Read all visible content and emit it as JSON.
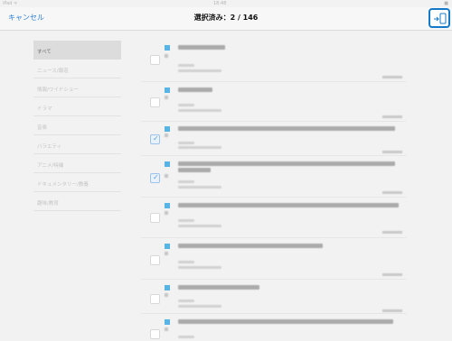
{
  "status_bar": {
    "left": "iPad ᯤ",
    "center": "18:48",
    "right": "■"
  },
  "navbar": {
    "cancel_label": "キャンセル",
    "title": "選択済み：2 / 146"
  },
  "sidebar": {
    "items": [
      {
        "label": "すべて",
        "active": true
      },
      {
        "label": "ニュース/報道",
        "active": false
      },
      {
        "label": "情報/ワイドショー",
        "active": false
      },
      {
        "label": "ドラマ",
        "active": false
      },
      {
        "label": "音楽",
        "active": false
      },
      {
        "label": "バラエティ",
        "active": false
      },
      {
        "label": "アニメ/特撮",
        "active": false
      },
      {
        "label": "ドキュメンタリー/教養",
        "active": false
      },
      {
        "label": "趣味/教育",
        "active": false
      }
    ]
  },
  "recordings": [
    {
      "checked": false
    },
    {
      "checked": false
    },
    {
      "checked": true
    },
    {
      "checked": true
    },
    {
      "checked": false
    },
    {
      "checked": false
    },
    {
      "checked": false
    },
    {
      "checked": false
    }
  ]
}
